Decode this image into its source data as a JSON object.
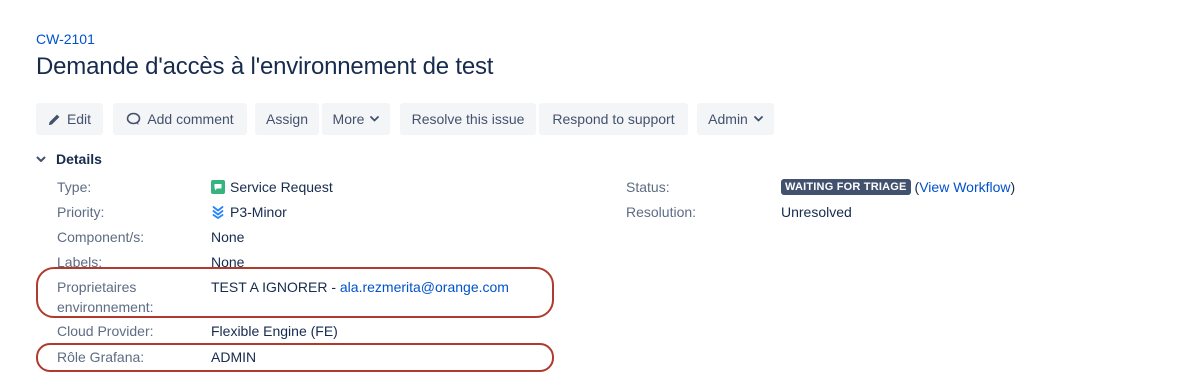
{
  "issue": {
    "key": "CW-2101",
    "title": "Demande d'accès à l'environnement de test"
  },
  "toolbar": {
    "edit": "Edit",
    "add_comment": "Add comment",
    "assign": "Assign",
    "more": "More",
    "resolve": "Resolve this issue",
    "respond": "Respond to support",
    "admin": "Admin"
  },
  "details": {
    "heading": "Details",
    "type": {
      "label": "Type:",
      "value": "Service Request"
    },
    "priority": {
      "label": "Priority:",
      "value": "P3-Minor"
    },
    "components": {
      "label": "Component/s:",
      "value": "None"
    },
    "labels": {
      "label": "Labels:",
      "value": "None"
    },
    "owners": {
      "label_line1": "Proprietaires",
      "label_line2": "environnement:",
      "value_prefix": "TEST A IGNORER - ",
      "email": "ala.rezmerita@orange.com"
    },
    "cloud_provider": {
      "label": "Cloud Provider:",
      "value": "Flexible Engine (FE)"
    },
    "grafana_role": {
      "label": "Rôle Grafana:",
      "value": "ADMIN"
    },
    "status": {
      "label": "Status:",
      "value": "WAITING FOR TRIAGE",
      "open_paren": "(",
      "workflow_link": "View Workflow",
      "close_paren": ")"
    },
    "resolution": {
      "label": "Resolution:",
      "value": "Unresolved"
    }
  },
  "colors": {
    "link": "#0052cc",
    "lozenge_bg": "#42526e",
    "highlight_border": "#b03a2e",
    "service_request_icon": "#36b37e",
    "priority_icon": "#2684ff"
  },
  "icons": {
    "edit": "pencil-icon",
    "comment": "comment-icon",
    "dropdown": "chevron-down-icon",
    "details_toggle": "chevron-down-icon",
    "type": "service-request-icon",
    "priority": "priority-minor-icon"
  }
}
